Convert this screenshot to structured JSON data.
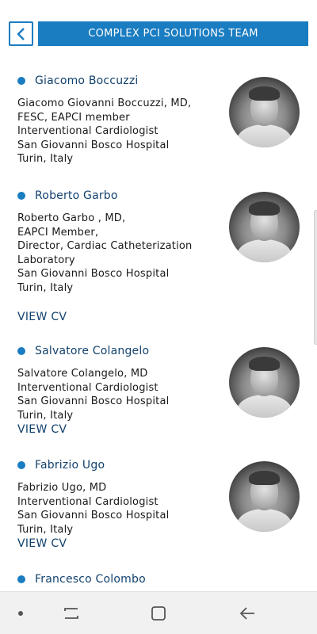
{
  "header": {
    "title": "COMPLEX PCI SOLUTIONS TEAM"
  },
  "members": [
    {
      "name": "Giacomo Boccuzzi",
      "lines": [
        "Giacomo Giovanni Boccuzzi, MD,",
        "FESC, EAPCI member",
        "Interventional Cardiologist",
        "San Giovanni Bosco Hospital",
        "Turin, Italy"
      ]
    },
    {
      "name": "Roberto Garbo",
      "lines": [
        "Roberto Garbo , MD,",
        "EAPCI Member,",
        "Director, Cardiac Catheterization",
        "Laboratory",
        "San Giovanni Bosco Hospital",
        "Turin, Italy"
      ],
      "link": "VIEW CV"
    },
    {
      "name": "Salvatore Colangelo",
      "lines": [
        "Salvatore Colangelo, MD",
        "Interventional Cardiologist",
        "San Giovanni Bosco Hospital",
        "Turin, Italy"
      ],
      "link": "VIEW CV"
    },
    {
      "name": "Fabrizio Ugo",
      "lines": [
        "Fabrizio Ugo, MD",
        "Interventional Cardiologist",
        "San Giovanni Bosco Hospital",
        "Turin, Italy"
      ],
      "link": "VIEW CV"
    },
    {
      "name": "Francesco Colombo"
    }
  ],
  "icons": {
    "back": "chevron-left-icon",
    "nav_dot": "dot-icon",
    "nav_recents": "recent-apps-icon",
    "nav_home": "home-icon",
    "nav_back": "back-arrow-icon"
  },
  "colors": {
    "accent": "#1a7cc1",
    "name_text": "#12426e",
    "navbar": "#f1f1f1"
  }
}
